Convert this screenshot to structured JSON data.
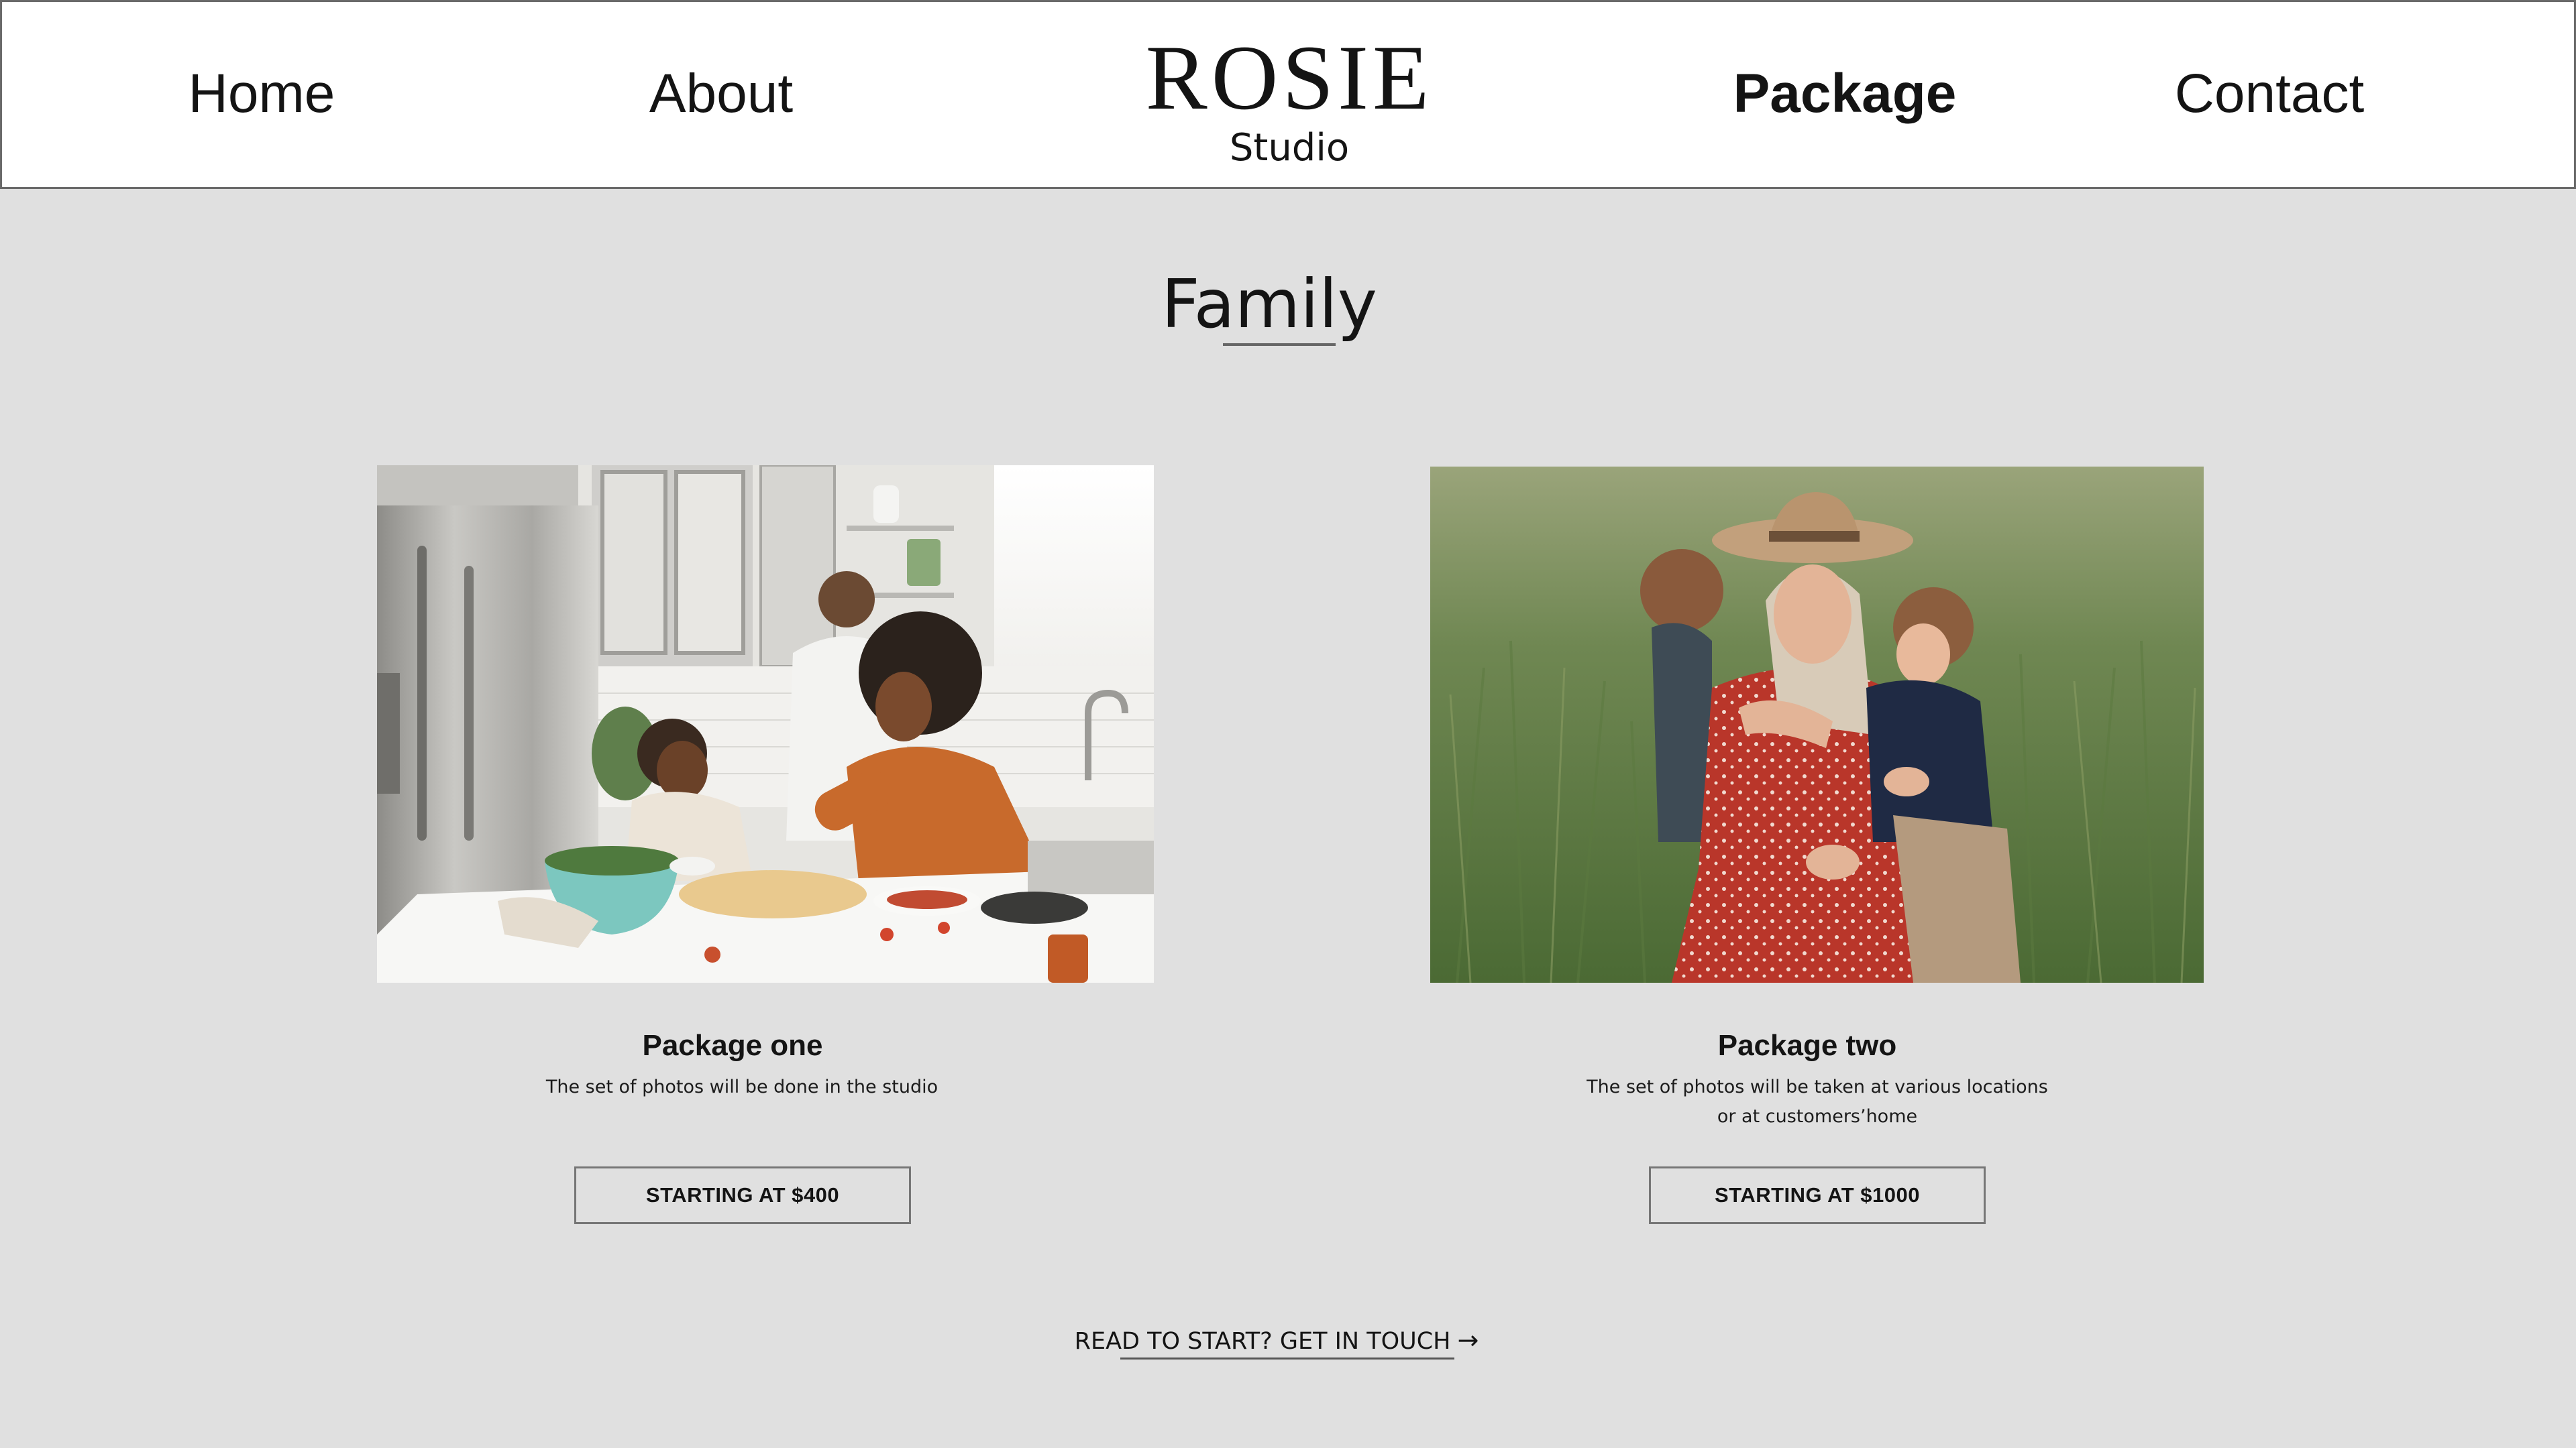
{
  "nav": {
    "home": "Home",
    "about": "About",
    "package": "Package",
    "contact": "Contact"
  },
  "logo": {
    "word": "ROSIE",
    "sub": "Studio"
  },
  "section": {
    "title": "Family"
  },
  "packages": [
    {
      "title": "Package one",
      "description": "The set of photos will be done in the studio",
      "price_label": "STARTING AT $400"
    },
    {
      "title": "Package two",
      "description": "The set of photos will be taken at various locations or at customers’home",
      "price_label": "STARTING AT $1000"
    }
  ],
  "cta": {
    "label": "READ TO START? GET IN TOUCH",
    "arrow": "→"
  },
  "colors": {
    "background": "#e0e0e0",
    "header_background": "#ffffff",
    "text": "#141414",
    "border": "#767676"
  }
}
